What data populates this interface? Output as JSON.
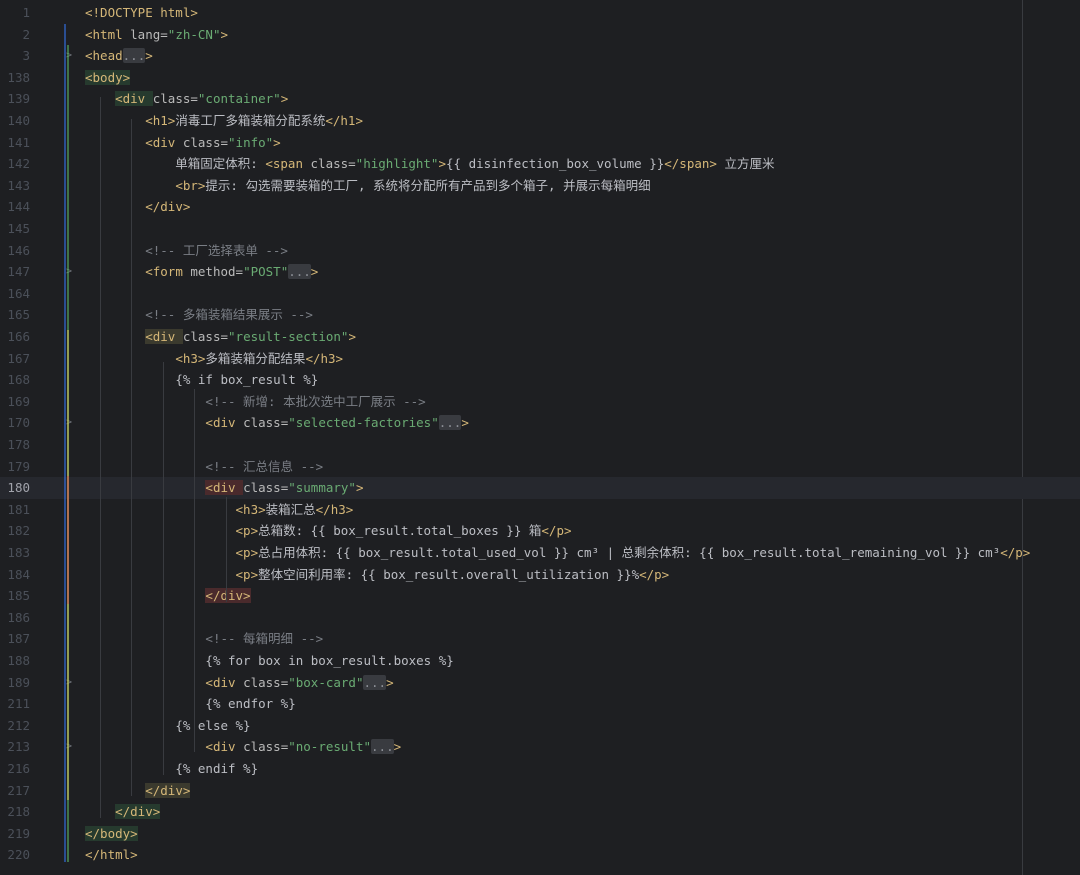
{
  "editor": {
    "lines": [
      {
        "n": "1",
        "fold": "",
        "segs": [
          {
            "t": "<!DOCTYPE html>",
            "c": "tag"
          }
        ]
      },
      {
        "n": "2",
        "fold": "",
        "segs": [
          {
            "t": "<html ",
            "c": "tag"
          },
          {
            "t": "lang=",
            "c": "attr"
          },
          {
            "t": "\"zh-CN\"",
            "c": "str"
          },
          {
            "t": ">",
            "c": "tag"
          }
        ]
      },
      {
        "n": "3",
        "fold": ">",
        "segs": [
          {
            "t": "<head",
            "c": "tag"
          },
          {
            "t": "...",
            "c": "fold-ph"
          },
          {
            "t": ">",
            "c": "tag"
          }
        ]
      },
      {
        "n": "138",
        "fold": "",
        "segs": [
          {
            "t": "<body>",
            "c": "tag hl-tag-g"
          }
        ]
      },
      {
        "n": "139",
        "fold": "",
        "segs": [
          {
            "t": "    "
          },
          {
            "t": "<div ",
            "c": "tag hl-tag-g"
          },
          {
            "t": "class=",
            "c": "attr"
          },
          {
            "t": "\"container\"",
            "c": "str"
          },
          {
            "t": ">",
            "c": "tag"
          }
        ]
      },
      {
        "n": "140",
        "fold": "",
        "segs": [
          {
            "t": "        "
          },
          {
            "t": "<h1>",
            "c": "tag"
          },
          {
            "t": "消毒工厂多箱装箱分配系统"
          },
          {
            "t": "</h1>",
            "c": "tag"
          }
        ]
      },
      {
        "n": "141",
        "fold": "",
        "segs": [
          {
            "t": "        "
          },
          {
            "t": "<div ",
            "c": "tag"
          },
          {
            "t": "class=",
            "c": "attr"
          },
          {
            "t": "\"info\"",
            "c": "str"
          },
          {
            "t": ">",
            "c": "tag"
          }
        ]
      },
      {
        "n": "142",
        "fold": "",
        "segs": [
          {
            "t": "            单箱固定体积: "
          },
          {
            "t": "<span ",
            "c": "tag"
          },
          {
            "t": "class=",
            "c": "attr"
          },
          {
            "t": "\"highlight\"",
            "c": "str"
          },
          {
            "t": ">",
            "c": "tag"
          },
          {
            "t": "{{ disinfection_box_volume }}"
          },
          {
            "t": "</span>",
            "c": "tag"
          },
          {
            "t": " 立方厘米"
          }
        ]
      },
      {
        "n": "143",
        "fold": "",
        "segs": [
          {
            "t": "            "
          },
          {
            "t": "<br>",
            "c": "tag"
          },
          {
            "t": "提示: 勾选需要装箱的工厂, 系统将分配所有产品到多个箱子, 并展示每箱明细"
          }
        ]
      },
      {
        "n": "144",
        "fold": "",
        "segs": [
          {
            "t": "        "
          },
          {
            "t": "</div>",
            "c": "tag"
          }
        ]
      },
      {
        "n": "145",
        "fold": "",
        "segs": []
      },
      {
        "n": "146",
        "fold": "",
        "segs": [
          {
            "t": "        "
          },
          {
            "t": "<!-- 工厂选择表单 -->",
            "c": "cmt"
          }
        ]
      },
      {
        "n": "147",
        "fold": ">",
        "segs": [
          {
            "t": "        "
          },
          {
            "t": "<form ",
            "c": "tag"
          },
          {
            "t": "method=",
            "c": "attr"
          },
          {
            "t": "\"POST\"",
            "c": "str"
          },
          {
            "t": "...",
            "c": "fold-ph"
          },
          {
            "t": ">",
            "c": "tag"
          }
        ]
      },
      {
        "n": "164",
        "fold": "",
        "segs": []
      },
      {
        "n": "165",
        "fold": "",
        "segs": [
          {
            "t": "        "
          },
          {
            "t": "<!-- 多箱装箱结果展示 -->",
            "c": "cmt"
          }
        ]
      },
      {
        "n": "166",
        "fold": "",
        "segs": [
          {
            "t": "        "
          },
          {
            "t": "<div ",
            "c": "tag hl-tag"
          },
          {
            "t": "class=",
            "c": "attr"
          },
          {
            "t": "\"result-section\"",
            "c": "str"
          },
          {
            "t": ">",
            "c": "tag"
          }
        ]
      },
      {
        "n": "167",
        "fold": "",
        "segs": [
          {
            "t": "            "
          },
          {
            "t": "<h3>",
            "c": "tag"
          },
          {
            "t": "多箱装箱分配结果"
          },
          {
            "t": "</h3>",
            "c": "tag"
          }
        ]
      },
      {
        "n": "168",
        "fold": "",
        "segs": [
          {
            "t": "            "
          },
          {
            "t": "{% if box_result %}",
            "c": "tpl"
          }
        ]
      },
      {
        "n": "169",
        "fold": "",
        "segs": [
          {
            "t": "                "
          },
          {
            "t": "<!-- 新增: 本批次选中工厂展示 -->",
            "c": "cmt"
          }
        ]
      },
      {
        "n": "170",
        "fold": ">",
        "segs": [
          {
            "t": "                "
          },
          {
            "t": "<div ",
            "c": "tag"
          },
          {
            "t": "class=",
            "c": "attr"
          },
          {
            "t": "\"selected-factories\"",
            "c": "str"
          },
          {
            "t": "...",
            "c": "fold-ph"
          },
          {
            "t": ">",
            "c": "tag"
          }
        ]
      },
      {
        "n": "178",
        "fold": "",
        "segs": []
      },
      {
        "n": "179",
        "fold": "",
        "segs": [
          {
            "t": "                "
          },
          {
            "t": "<!-- 汇总信息 -->",
            "c": "cmt"
          }
        ]
      },
      {
        "n": "180",
        "fold": "",
        "current": true,
        "segs": [
          {
            "t": "                "
          },
          {
            "t": "<div ",
            "c": "tag hl-tag-r"
          },
          {
            "t": "class=",
            "c": "attr"
          },
          {
            "t": "\"summary\"",
            "c": "str"
          },
          {
            "t": ">",
            "c": "tag"
          }
        ]
      },
      {
        "n": "181",
        "fold": "",
        "segs": [
          {
            "t": "                    "
          },
          {
            "t": "<h3>",
            "c": "tag"
          },
          {
            "t": "装箱汇总"
          },
          {
            "t": "</h3>",
            "c": "tag"
          }
        ]
      },
      {
        "n": "182",
        "fold": "",
        "segs": [
          {
            "t": "                    "
          },
          {
            "t": "<p>",
            "c": "tag"
          },
          {
            "t": "总箱数: {{ box_result.total_boxes }} 箱"
          },
          {
            "t": "</p>",
            "c": "tag"
          }
        ]
      },
      {
        "n": "183",
        "fold": "",
        "segs": [
          {
            "t": "                    "
          },
          {
            "t": "<p>",
            "c": "tag"
          },
          {
            "t": "总占用体积: {{ box_result.total_used_vol }} cm³ | 总剩余体积: {{ box_result.total_remaining_vol }} cm³"
          },
          {
            "t": "</p>",
            "c": "tag"
          }
        ]
      },
      {
        "n": "184",
        "fold": "",
        "segs": [
          {
            "t": "                    "
          },
          {
            "t": "<p>",
            "c": "tag"
          },
          {
            "t": "整体空间利用率: {{ box_result.overall_utilization }}%"
          },
          {
            "t": "</p>",
            "c": "tag"
          }
        ]
      },
      {
        "n": "185",
        "fold": "",
        "segs": [
          {
            "t": "                "
          },
          {
            "t": "</div>",
            "c": "tag hl-tag-r"
          }
        ]
      },
      {
        "n": "186",
        "fold": "",
        "segs": []
      },
      {
        "n": "187",
        "fold": "",
        "segs": [
          {
            "t": "                "
          },
          {
            "t": "<!-- 每箱明细 -->",
            "c": "cmt"
          }
        ]
      },
      {
        "n": "188",
        "fold": "",
        "segs": [
          {
            "t": "                "
          },
          {
            "t": "{% for box in box_result.boxes %}",
            "c": "tpl"
          }
        ]
      },
      {
        "n": "189",
        "fold": ">",
        "segs": [
          {
            "t": "                "
          },
          {
            "t": "<div ",
            "c": "tag"
          },
          {
            "t": "class=",
            "c": "attr"
          },
          {
            "t": "\"box-card\"",
            "c": "str"
          },
          {
            "t": "...",
            "c": "fold-ph"
          },
          {
            "t": ">",
            "c": "tag"
          }
        ]
      },
      {
        "n": "211",
        "fold": "",
        "segs": [
          {
            "t": "                "
          },
          {
            "t": "{% endfor %}",
            "c": "tpl"
          }
        ]
      },
      {
        "n": "212",
        "fold": "",
        "segs": [
          {
            "t": "            "
          },
          {
            "t": "{% else %}",
            "c": "tpl"
          }
        ]
      },
      {
        "n": "213",
        "fold": ">",
        "segs": [
          {
            "t": "                "
          },
          {
            "t": "<div ",
            "c": "tag"
          },
          {
            "t": "class=",
            "c": "attr"
          },
          {
            "t": "\"no-result\"",
            "c": "str"
          },
          {
            "t": "...",
            "c": "fold-ph"
          },
          {
            "t": ">",
            "c": "tag"
          }
        ]
      },
      {
        "n": "216",
        "fold": "",
        "segs": [
          {
            "t": "            "
          },
          {
            "t": "{% endif %}",
            "c": "tpl"
          }
        ]
      },
      {
        "n": "217",
        "fold": "",
        "segs": [
          {
            "t": "        "
          },
          {
            "t": "</div>",
            "c": "tag hl-tag"
          }
        ]
      },
      {
        "n": "218",
        "fold": "",
        "segs": [
          {
            "t": "    "
          },
          {
            "t": "</div>",
            "c": "tag hl-tag-g"
          }
        ]
      },
      {
        "n": "219",
        "fold": "",
        "segs": [
          {
            "t": "</body>",
            "c": "tag hl-tag-g"
          }
        ]
      },
      {
        "n": "220",
        "fold": "",
        "segs": [
          {
            "t": "</html>",
            "c": "tag"
          }
        ]
      }
    ]
  },
  "colors": {
    "background": "#1e1f22",
    "tag": "#d5b778",
    "attribute": "#bababa",
    "string": "#6aab73",
    "comment": "#7a7e85",
    "text": "#bcbec4",
    "line_number": "#4b5059",
    "scope_bar_blue": "#3574f0",
    "scope_bar_green": "#5fb865",
    "scope_bar_yellow": "#d9c15f",
    "scope_bar_red": "#c94f4f"
  }
}
